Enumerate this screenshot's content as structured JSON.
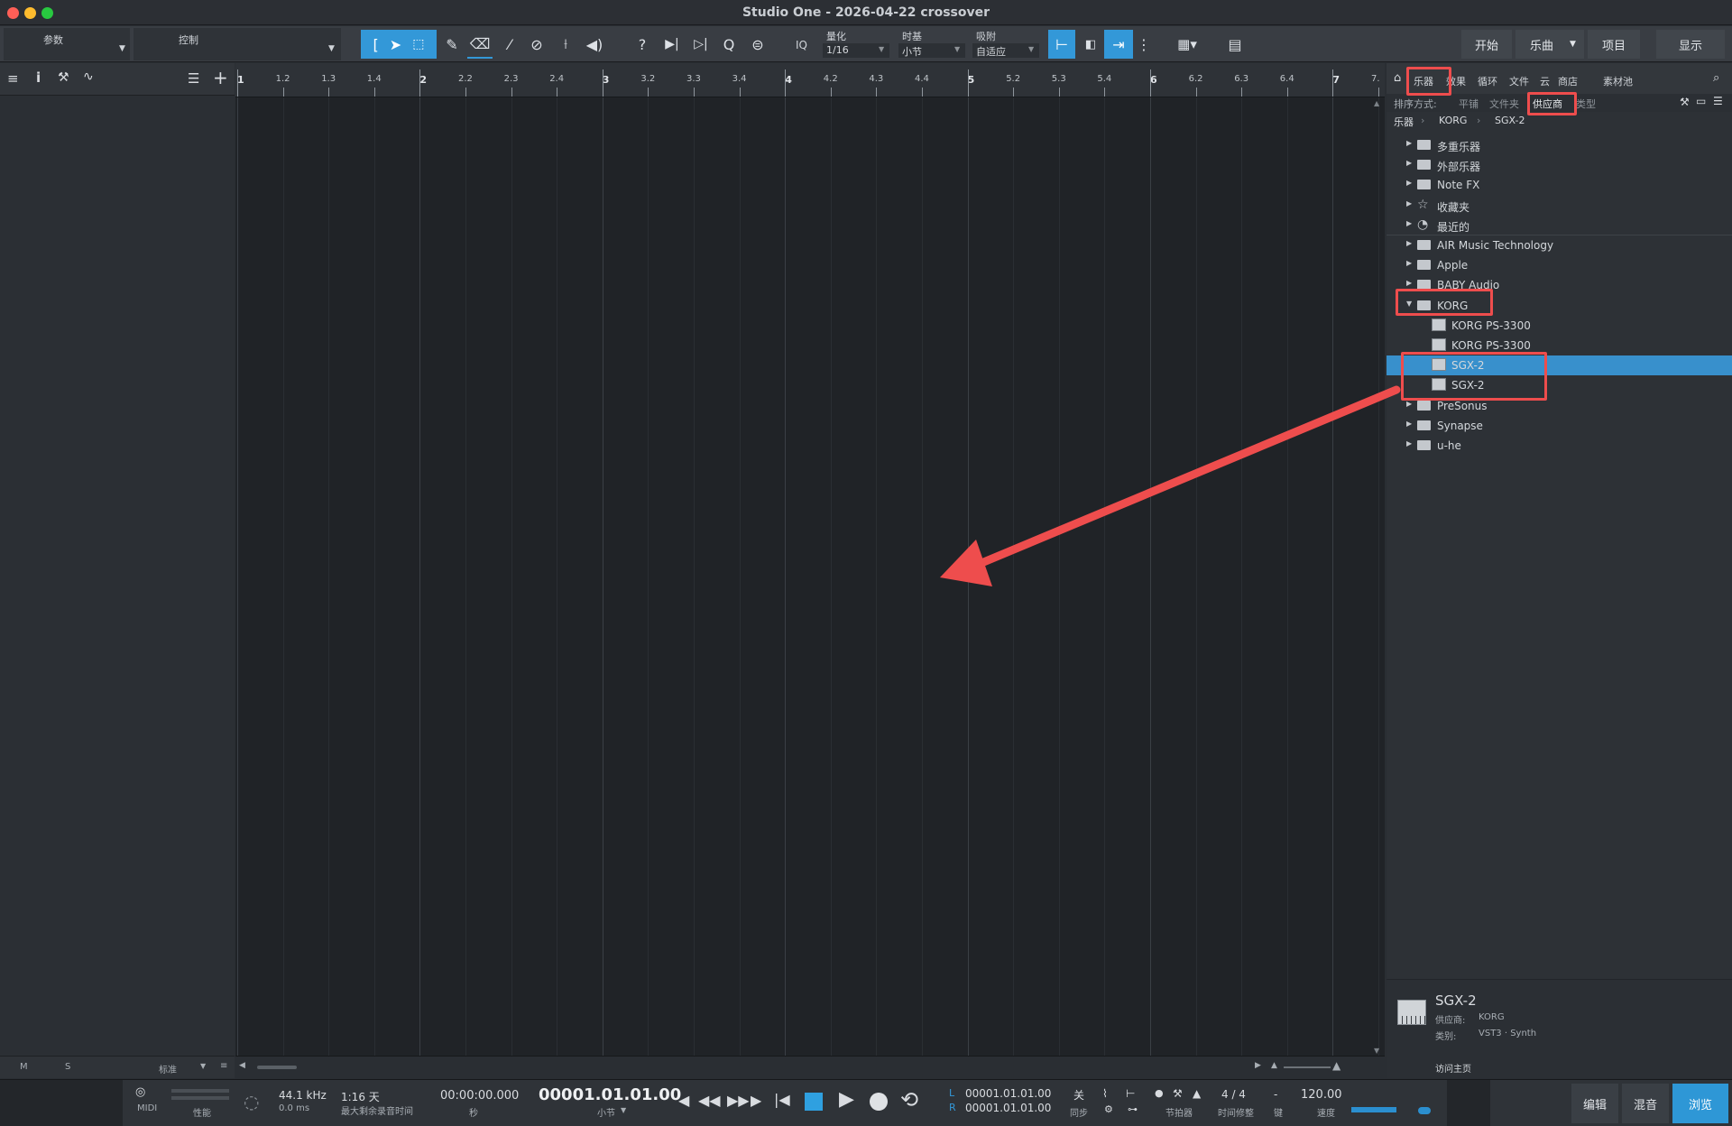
{
  "window": {
    "title": "Studio One - 2026-04-22 crossover"
  },
  "toolbar": {
    "params_label": "参数",
    "control_label": "控制",
    "iq_label": "IQ",
    "quantize_label": "量化",
    "quantize_value": "1/16",
    "timebase_label": "时基",
    "timebase_value": "小节",
    "snap_label": "吸附",
    "snap_value": "自适应",
    "help_icon": "?"
  },
  "nav": {
    "start": "开始",
    "song": "乐曲",
    "project": "项目",
    "show": "显示"
  },
  "ruler": {
    "labels": [
      "1",
      "1.2",
      "1.3",
      "1.4",
      "2",
      "2.2",
      "2.3",
      "2.4",
      "3",
      "3.2",
      "3.3",
      "3.4",
      "4",
      "4.2",
      "4.3",
      "4.4",
      "5",
      "5.2",
      "5.3",
      "5.4",
      "6",
      "6.2",
      "6.3",
      "6.4",
      "7",
      "7."
    ]
  },
  "browser": {
    "tabs": [
      "乐器",
      "效果",
      "循环",
      "文件",
      "云",
      "商店",
      "素材池"
    ],
    "sort_label": "排序方式:",
    "sort_options": [
      "平铺",
      "文件夹",
      "供应商",
      "类型"
    ],
    "breadcrumb": [
      "乐器",
      "KORG",
      "SGX-2"
    ],
    "tree": [
      {
        "label": "多重乐器",
        "icon": "multi-instrument-icon",
        "level": 1
      },
      {
        "label": "外部乐器",
        "icon": "external-instrument-icon",
        "level": 1
      },
      {
        "label": "Note FX",
        "icon": "folder-icon",
        "level": 1
      },
      {
        "label": "收藏夹",
        "icon": "star-icon",
        "level": 1
      },
      {
        "label": "最近的",
        "icon": "clock-icon",
        "level": 1
      },
      {
        "label": "AIR Music Technology",
        "icon": "folder-icon",
        "level": 1
      },
      {
        "label": "Apple",
        "icon": "folder-icon",
        "level": 1
      },
      {
        "label": "BABY Audio",
        "icon": "folder-icon",
        "level": 1
      },
      {
        "label": "KORG",
        "icon": "folder-open-icon",
        "level": 1,
        "expanded": true
      },
      {
        "label": "KORG PS-3300",
        "icon": "keyboard-icon",
        "level": 2
      },
      {
        "label": "KORG PS-3300",
        "icon": "keyboard-icon",
        "level": 2
      },
      {
        "label": "SGX-2",
        "icon": "keyboard-icon",
        "level": 2,
        "selected": true
      },
      {
        "label": "SGX-2",
        "icon": "keyboard-icon",
        "level": 2
      },
      {
        "label": "PreSonus",
        "icon": "folder-icon",
        "level": 1
      },
      {
        "label": "Synapse",
        "icon": "folder-icon",
        "level": 1
      },
      {
        "label": "u-he",
        "icon": "folder-icon",
        "level": 1
      }
    ],
    "info": {
      "name": "SGX-2",
      "vendor_label": "供应商:",
      "vendor": "KORG",
      "category_label": "类别:",
      "category": "VST3 · Synth",
      "homepage": "访问主页"
    }
  },
  "left": {
    "m_label": "M",
    "s_label": "S",
    "mode": "标准"
  },
  "transport": {
    "midi": "MIDI",
    "perf": "性能",
    "samplerate": "44.1 kHz",
    "latency": "0.0 ms",
    "remaining": "1:16 天",
    "remaining_label": "最大剩余录音时间",
    "time": "00:00:00.000",
    "time_unit": "秒",
    "position": "00001.01.01.00",
    "position_unit": "小节",
    "loop_l_label": "L",
    "loop_r_label": "R",
    "loop_l": "00001.01.01.00",
    "loop_r": "00001.01.01.00",
    "sync_value": "关",
    "sync_label": "同步",
    "metronome_label": "节拍器",
    "timesig": "4 / 4",
    "timesig_label": "时间修整",
    "key_value": "-",
    "key_label": "键",
    "tempo": "120.00",
    "tempo_label": "速度",
    "edit": "编辑",
    "mix": "混音",
    "browse": "浏览"
  },
  "colors": {
    "accent": "#3398d8",
    "selection": "#3890cc",
    "annotation": "#ee4d4d"
  }
}
